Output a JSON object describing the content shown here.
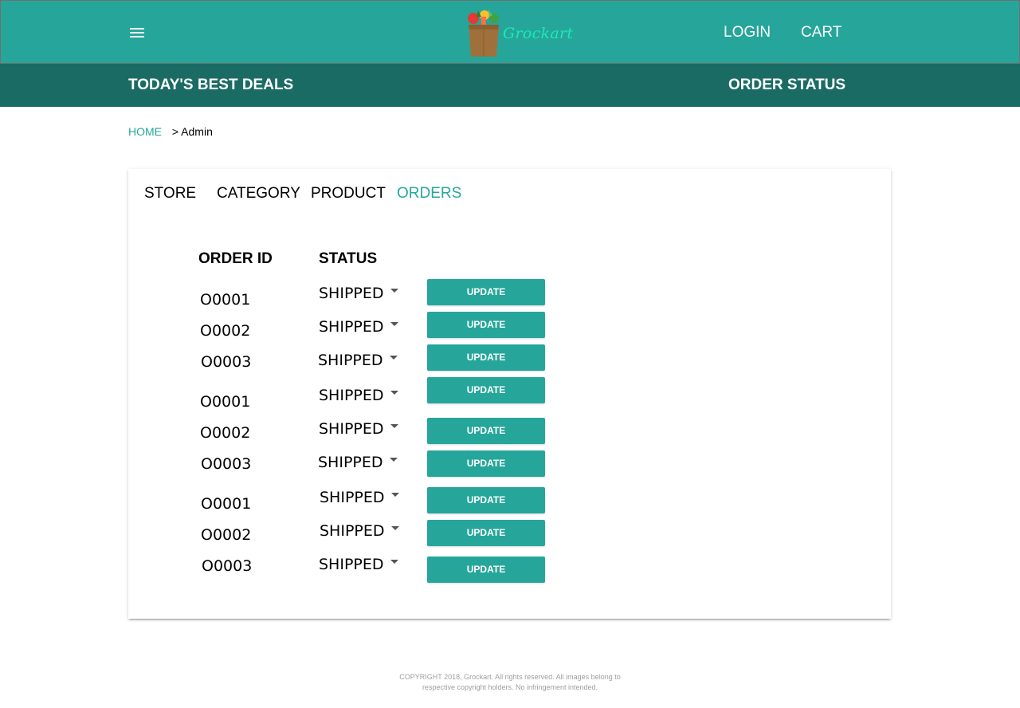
{
  "header": {
    "brand": "Grockart",
    "login_label": "LOGIN",
    "cart_label": "CART"
  },
  "subnav": {
    "deals_label": "TODAY'S BEST DEALS",
    "order_status_label": "ORDER STATUS"
  },
  "breadcrumb": {
    "home": "HOME",
    "current": "> Admin"
  },
  "tabs": [
    {
      "label": "STORE",
      "active": false
    },
    {
      "label": "CATEGORY",
      "active": false
    },
    {
      "label": "PRODUCT",
      "active": false
    },
    {
      "label": "ORDERS",
      "active": true
    }
  ],
  "orders_table": {
    "headers": {
      "order_id": "ORDER ID",
      "status": "STATUS"
    },
    "update_label": "UPDATE",
    "rows": [
      {
        "order_id": "O0001",
        "status": "SHIPPED"
      },
      {
        "order_id": "O0002",
        "status": "SHIPPED"
      },
      {
        "order_id": "O0003",
        "status": "SHIPPED"
      },
      {
        "order_id": "O0001",
        "status": "SHIPPED"
      },
      {
        "order_id": "O0002",
        "status": "SHIPPED"
      },
      {
        "order_id": "O0003",
        "status": "SHIPPED"
      },
      {
        "order_id": "O0001",
        "status": "SHIPPED"
      },
      {
        "order_id": "O0002",
        "status": "SHIPPED"
      },
      {
        "order_id": "O0003",
        "status": "SHIPPED"
      }
    ]
  },
  "footer": {
    "line1": "COPYRIGHT 2018, Grockart. All rights reserved. All images belong to",
    "line2": "respective copyright holders. No infringement intended."
  },
  "colors": {
    "primary": "#26a69a",
    "primary_dark": "#1b6b65",
    "brand_text": "#1de9b6"
  },
  "icons": [
    "menu-icon",
    "grocery-bag-logo"
  ]
}
